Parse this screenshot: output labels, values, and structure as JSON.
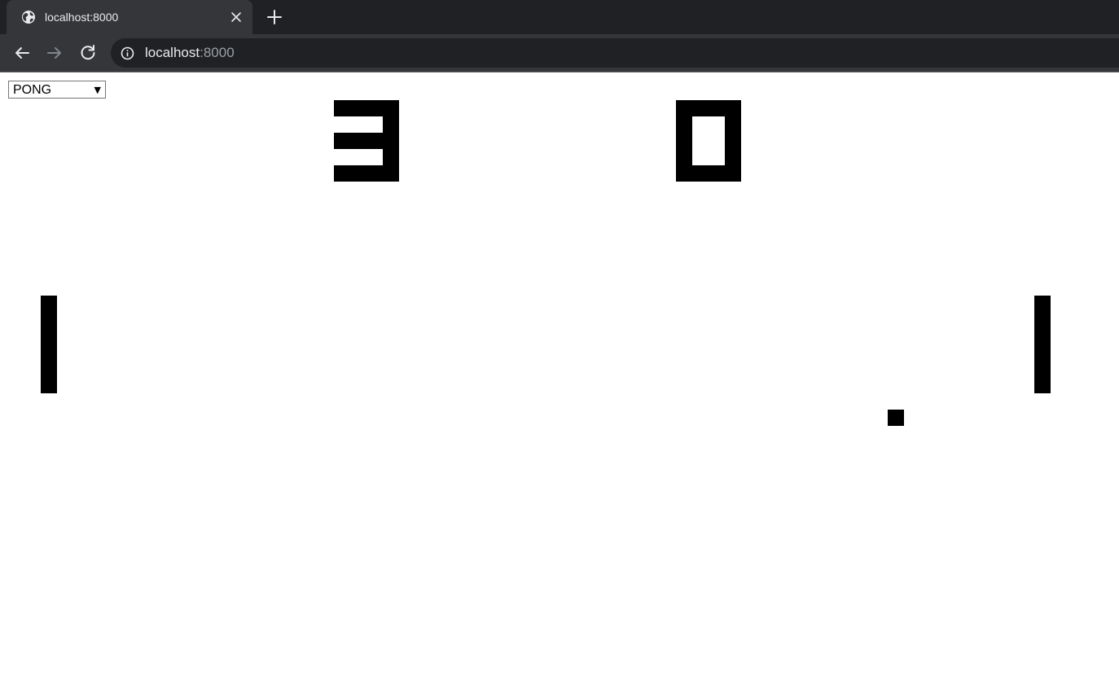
{
  "browser": {
    "tab_title": "localhost:8000",
    "url_host": "localhost",
    "url_port": ":8000",
    "icons": {
      "favicon": "globe-icon",
      "close": "close-icon",
      "new_tab": "plus-icon",
      "back": "back-arrow-icon",
      "forward": "forward-arrow-icon",
      "reload": "reload-icon",
      "site_info": "info-icon"
    }
  },
  "game_select": {
    "selected": "PONG",
    "arrow": "▼"
  },
  "game": {
    "score_left": "3",
    "score_right": "0",
    "colors": {
      "foreground": "#000000",
      "background": "#ffffff"
    }
  }
}
